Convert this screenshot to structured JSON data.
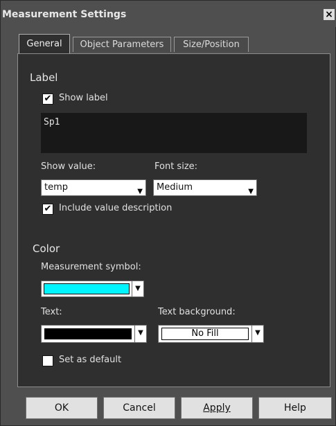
{
  "window": {
    "title": "Measurement Settings",
    "close_glyph": "×"
  },
  "tabs": [
    {
      "label": "General",
      "active": true
    },
    {
      "label": "Object Parameters",
      "active": false
    },
    {
      "label": "Size/Position",
      "active": false
    }
  ],
  "label_section": {
    "heading": "Label",
    "show_label": {
      "label": "Show label",
      "checked": true
    },
    "label_text": "Sp1",
    "show_value": {
      "label": "Show value:",
      "value": "temp"
    },
    "font_size": {
      "label": "Font size:",
      "value": "Medium"
    },
    "include_desc": {
      "label": "Include value description",
      "checked": true
    }
  },
  "color_section": {
    "heading": "Color",
    "measurement_symbol": {
      "label": "Measurement symbol:",
      "color": "#00f5ff"
    },
    "text": {
      "label": "Text:",
      "color": "#000000"
    },
    "text_background": {
      "label": "Text background:",
      "value": "No Fill"
    },
    "set_default": {
      "label": "Set as default",
      "checked": false
    }
  },
  "buttons": {
    "ok": "OK",
    "cancel": "Cancel",
    "apply": "Apply",
    "help": "Help"
  },
  "glyphs": {
    "check": "✔",
    "caret": "▼"
  }
}
